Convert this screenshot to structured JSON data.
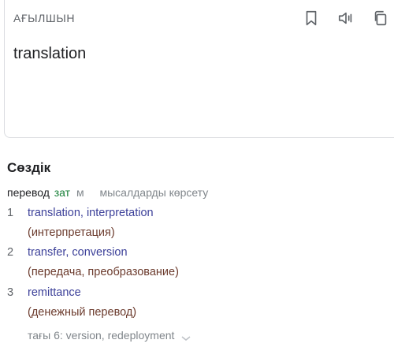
{
  "source": {
    "language": "АҒЫЛШЫН",
    "text": "translation"
  },
  "toolbar": {
    "icons": [
      "bookmark-icon",
      "speaker-icon",
      "copy-icon"
    ]
  },
  "dictionary": {
    "title": "Сөздік",
    "headword": "перевод",
    "pos": "зат",
    "gender": "м",
    "examples_link": "мысалдарды көрсету",
    "entries": [
      {
        "num": "1",
        "translations": "translation, interpretation",
        "back": "(интерпретация)"
      },
      {
        "num": "2",
        "translations": "transfer, conversion",
        "back": "(передача, преобразование)"
      },
      {
        "num": "3",
        "translations": "remittance",
        "back": "(денежный перевод)"
      }
    ],
    "more": "тағы 6: version, redeployment"
  },
  "colors": {
    "translation": "#3c4099",
    "back_translation": "#6b3a2c",
    "pos": "#188038",
    "muted": "#80868b"
  }
}
